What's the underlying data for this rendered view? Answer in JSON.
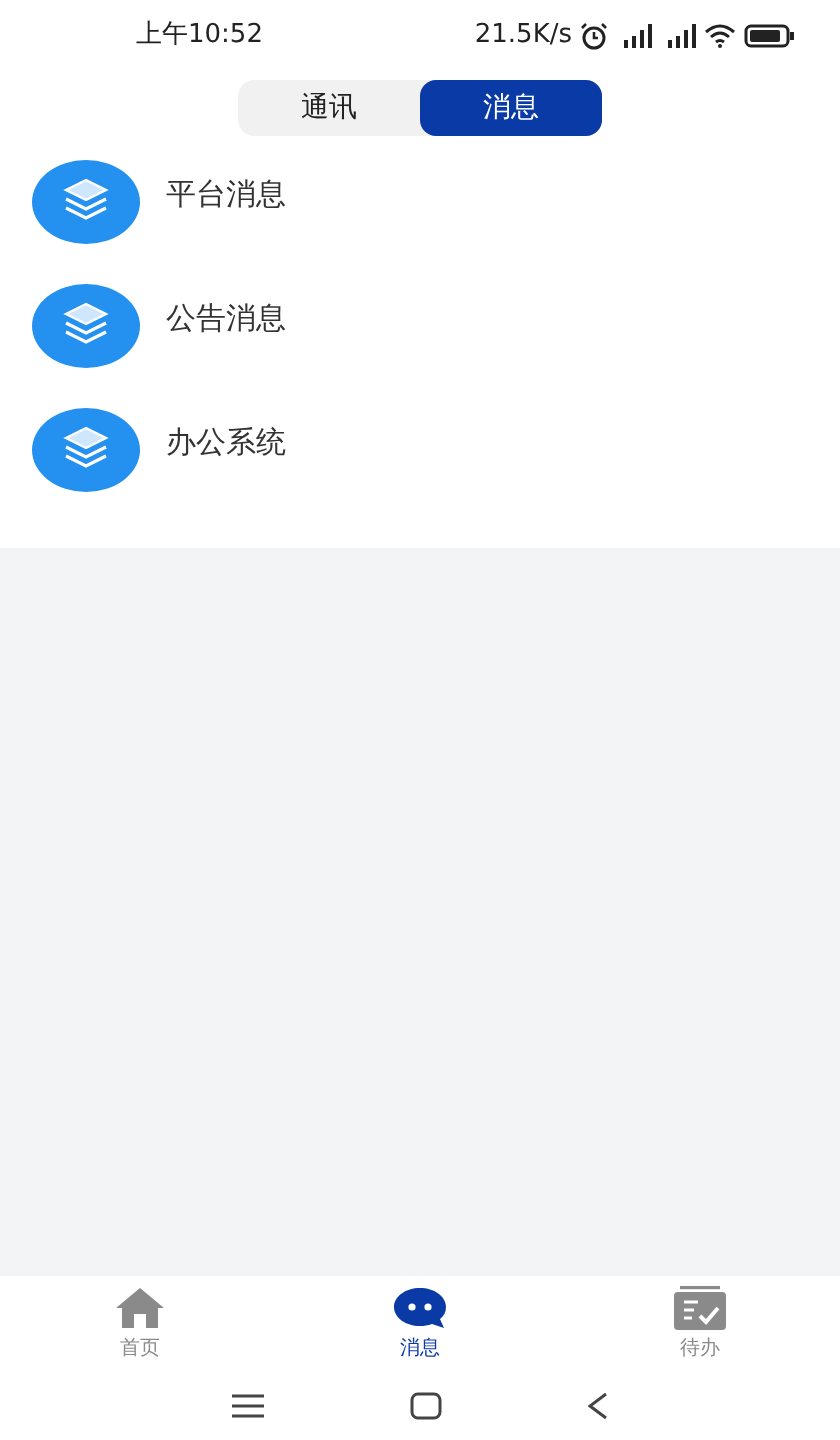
{
  "status_bar": {
    "time": "上午10:52",
    "speed": "21.5K/s"
  },
  "segments": [
    {
      "label": "通讯",
      "selected": false
    },
    {
      "label": "消息",
      "selected": true
    }
  ],
  "message_list": [
    {
      "title": "平台消息"
    },
    {
      "title": "公告消息"
    },
    {
      "title": "办公系统"
    }
  ],
  "bottom_nav": [
    {
      "kind": "home",
      "label": "首页",
      "selected": false
    },
    {
      "kind": "chat",
      "label": "消息",
      "selected": true
    },
    {
      "kind": "todo",
      "label": "待办",
      "selected": false
    }
  ]
}
